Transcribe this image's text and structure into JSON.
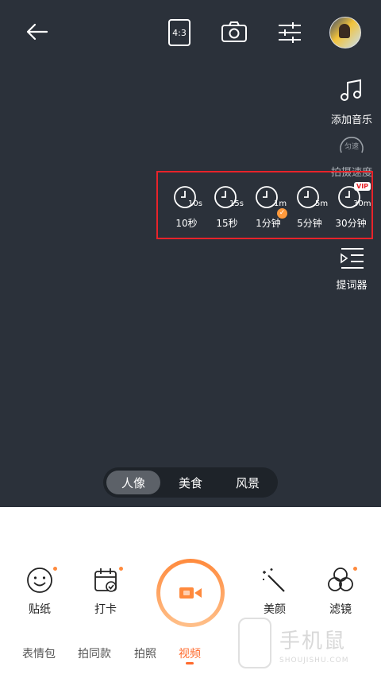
{
  "topbar": {
    "back_icon": "arrow-left-icon",
    "ratio_label": "4:3",
    "switch_camera_icon": "switch-camera-icon",
    "settings_icon": "sliders-icon",
    "avatar_icon": "album-thumbnail"
  },
  "side_menu": {
    "music_label": "添加音乐",
    "speed_badge": "匀速",
    "speed_label": "拍摄速度",
    "teleprompter_label": "提词器"
  },
  "durations": [
    {
      "badge": "10s",
      "label": "10秒",
      "selected": false,
      "vip": false
    },
    {
      "badge": "15s",
      "label": "15秒",
      "selected": false,
      "vip": false
    },
    {
      "badge": "1m",
      "label": "1分钟",
      "selected": true,
      "vip": false
    },
    {
      "badge": "5m",
      "label": "5分钟",
      "selected": false,
      "vip": false
    },
    {
      "badge": "30m",
      "label": "30分钟",
      "selected": false,
      "vip": true
    }
  ],
  "vip_label": "VIP",
  "highlight_color": "#e8232a",
  "accent_color": "#ff7a2e",
  "modes": [
    {
      "label": "人像",
      "active": true
    },
    {
      "label": "美食",
      "active": false
    },
    {
      "label": "风景",
      "active": false
    }
  ],
  "bottom_tools": {
    "sticker_label": "贴纸",
    "checkin_label": "打卡",
    "beauty_label": "美颜",
    "filter_label": "滤镜"
  },
  "tabs": [
    {
      "label": "表情包",
      "active": false
    },
    {
      "label": "拍同款",
      "active": false
    },
    {
      "label": "拍照",
      "active": false
    },
    {
      "label": "视频",
      "active": true
    }
  ],
  "watermark": {
    "cn": "手机鼠",
    "en": "SHOUJISHU.COM"
  }
}
